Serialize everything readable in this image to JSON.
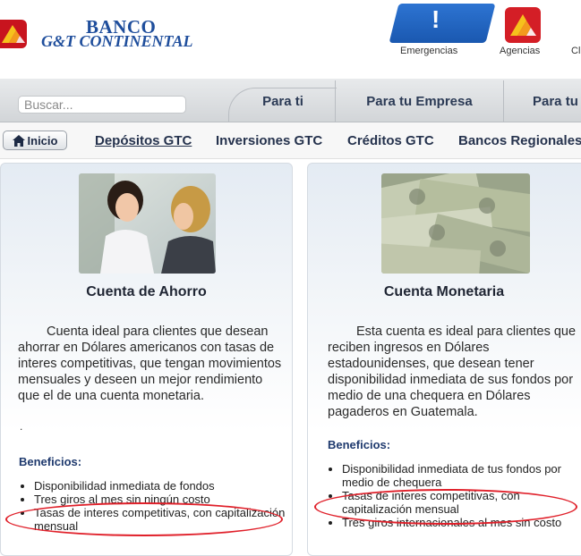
{
  "brand": {
    "line1": "BANCO",
    "line2": "G&T CONTINENTAL",
    "accent": "#c8141e",
    "blue": "#1f4e9c"
  },
  "quick_links": {
    "emergencias": "Emergencias",
    "agencias": "Agencias",
    "cut_off": "Cl"
  },
  "search": {
    "placeholder": "Buscar..."
  },
  "main_tabs": [
    "Para ti",
    "Para tu Empresa",
    "Para tu"
  ],
  "subnav": {
    "home": "Inicio",
    "items": [
      "Depósitos GTC",
      "Inversiones GTC",
      "Créditos GTC",
      "Bancos Regionales"
    ]
  },
  "cards": [
    {
      "title": "Cuenta de Ahorro",
      "description": "Cuenta ideal para clientes que desean ahorrar en Dólares americanos con tasas de interes competitivas, que tengan movimientos mensuales y deseen un mejor rendimiento que el de una cuenta monetaria.",
      "dot": ".",
      "benefits_title": "Beneficios:",
      "benefits": [
        "Disponibilidad inmediata de fondos",
        "Tres giros al mes sin ningún costo",
        "Tasas de interes competitivas, con capitalización mensual"
      ]
    },
    {
      "title": "Cuenta Monetaria",
      "description": "Esta cuenta es ideal para clientes que reciben ingresos en Dólares estadounidenses, que desean tener disponibilidad inmediata de sus fondos por medio de una chequera en Dólares pagaderos en Guatemala.",
      "benefits_title": "Beneficios:",
      "benefits": [
        "Disponibilidad inmediata de tus fondos por medio de chequera",
        "Tasas de interes competitivas, con capitalización mensual",
        "Tres giros internacionales al mes sin costo"
      ]
    }
  ],
  "highlight_color": "#e0202a"
}
